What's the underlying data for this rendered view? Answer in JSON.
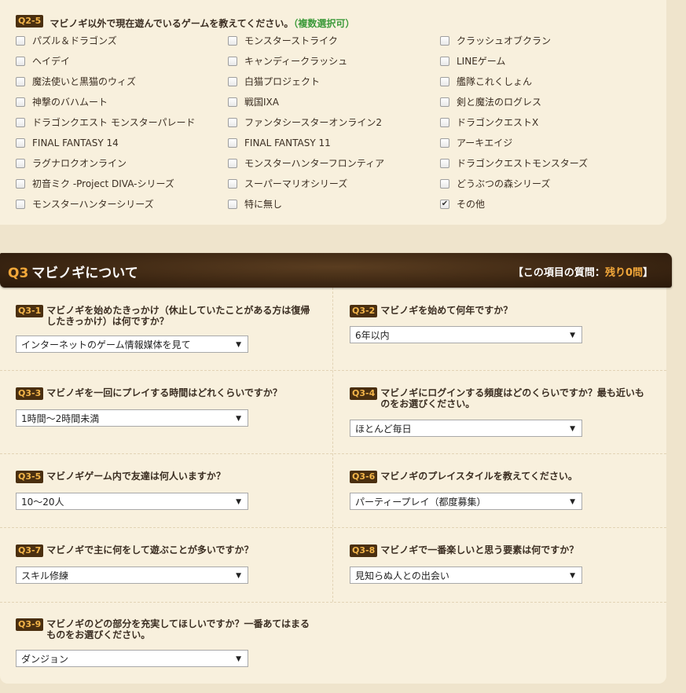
{
  "q25": {
    "tag": "Q2-5",
    "text": "マビノギ以外で現在遊んでいるゲームを教えてください。",
    "note": "（複数選択可）",
    "options": [
      {
        "label": "パズル＆ドラゴンズ",
        "checked": false
      },
      {
        "label": "モンスターストライク",
        "checked": false
      },
      {
        "label": "クラッシュオブクラン",
        "checked": false
      },
      {
        "label": "ヘイデイ",
        "checked": false
      },
      {
        "label": "キャンディークラッシュ",
        "checked": false
      },
      {
        "label": "LINEゲーム",
        "checked": false
      },
      {
        "label": "魔法使いと黒猫のウィズ",
        "checked": false
      },
      {
        "label": "白猫プロジェクト",
        "checked": false
      },
      {
        "label": "艦隊これくしょん",
        "checked": false
      },
      {
        "label": "神撃のバハムート",
        "checked": false
      },
      {
        "label": "戦国IXA",
        "checked": false
      },
      {
        "label": "剣と魔法のログレス",
        "checked": false
      },
      {
        "label": "ドラゴンクエスト モンスターパレード",
        "checked": false
      },
      {
        "label": "ファンタシースターオンライン2",
        "checked": false
      },
      {
        "label": "ドラゴンクエストX",
        "checked": false
      },
      {
        "label": "FINAL FANTASY 14",
        "checked": false
      },
      {
        "label": "FINAL FANTASY 11",
        "checked": false
      },
      {
        "label": "アーキエイジ",
        "checked": false
      },
      {
        "label": "ラグナロクオンライン",
        "checked": false
      },
      {
        "label": "モンスターハンターフロンティア",
        "checked": false
      },
      {
        "label": "ドラゴンクエストモンスターズ",
        "checked": false
      },
      {
        "label": "初音ミク -Project DIVA-シリーズ",
        "checked": false
      },
      {
        "label": "スーパーマリオシリーズ",
        "checked": false
      },
      {
        "label": "どうぶつの森シリーズ",
        "checked": false
      },
      {
        "label": "モンスターハンターシリーズ",
        "checked": false
      },
      {
        "label": "特に無し",
        "checked": false
      },
      {
        "label": "その他",
        "checked": true
      }
    ]
  },
  "section": {
    "num": "Q3",
    "title": "マビノギについて",
    "remaining_prefix": "【この項目の質問：",
    "remaining_value": "残り0問",
    "remaining_suffix": "】"
  },
  "questions": [
    {
      "tag": "Q3-1",
      "text": "マビノギを始めたきっかけ（休止していたことがある方は復帰したきっかけ）は何ですか？",
      "value": "インターネットのゲーム情報媒体を見て"
    },
    {
      "tag": "Q3-2",
      "text": "マビノギを始めて何年ですか？",
      "value": "6年以内"
    },
    {
      "tag": "Q3-3",
      "text": "マビノギを一回にプレイする時間はどれくらいですか？",
      "value": "1時間〜2時間未満"
    },
    {
      "tag": "Q3-4",
      "text": "マビノギにログインする頻度はどのくらいですか？最も近いものをお選びください。",
      "value": "ほとんど毎日"
    },
    {
      "tag": "Q3-5",
      "text": "マビノギゲーム内で友達は何人いますか？",
      "value": "10〜20人"
    },
    {
      "tag": "Q3-6",
      "text": "マビノギのプレイスタイルを教えてください。",
      "value": "パーティープレイ（都度募集）"
    },
    {
      "tag": "Q3-7",
      "text": "マビノギで主に何をして遊ぶことが多いですか？",
      "value": "スキル修練"
    },
    {
      "tag": "Q3-8",
      "text": "マビノギで一番楽しいと思う要素は何ですか？",
      "value": "見知らぬ人との出会い"
    },
    {
      "tag": "Q3-9",
      "text": "マビノギのどの部分を充実してほしいですか？一番あてはまるものをお選びください。",
      "value": "ダンジョン"
    }
  ],
  "icons": {
    "checkmark": "✔",
    "dropdown": "▼"
  }
}
